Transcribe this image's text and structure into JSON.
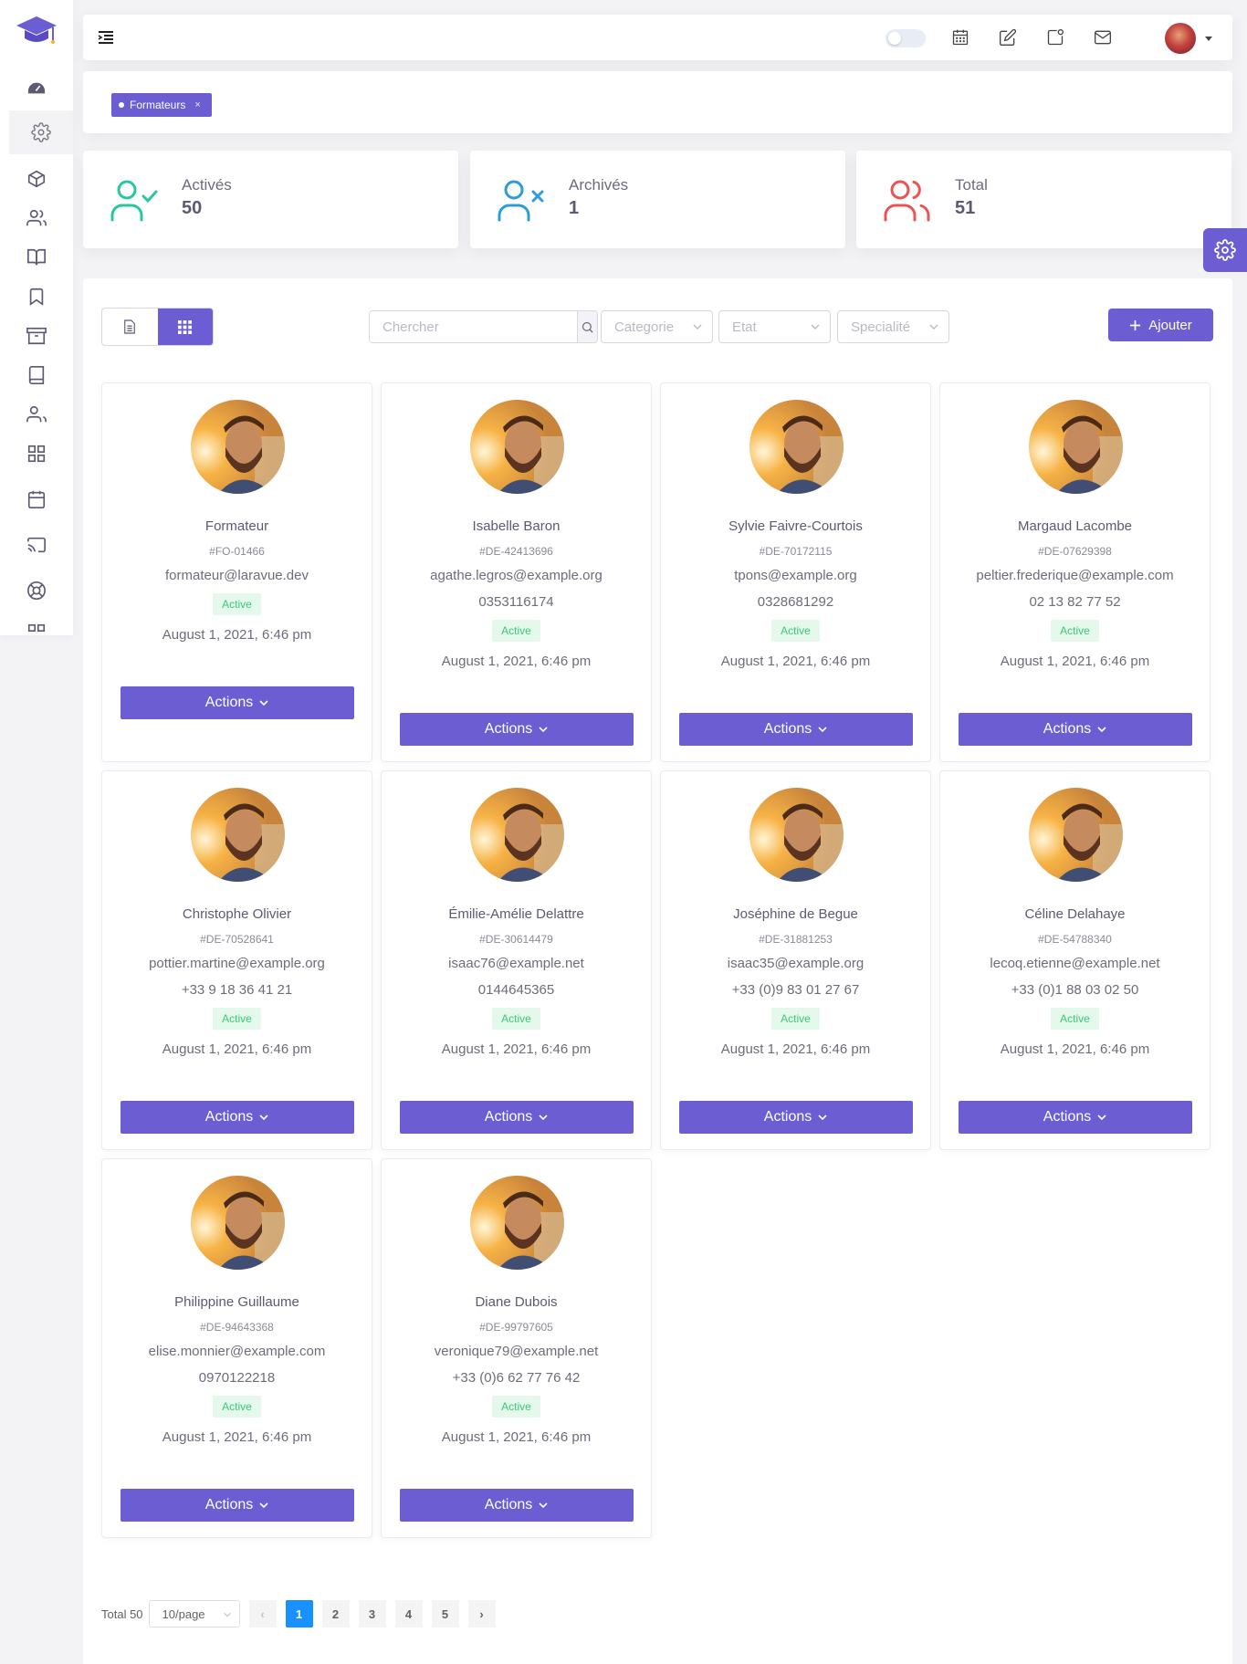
{
  "filter_tag": {
    "label": "Formateurs",
    "close": "×"
  },
  "stats": [
    {
      "label": "Activés",
      "value": "50",
      "color": "#28c7a0"
    },
    {
      "label": "Archivés",
      "value": "1",
      "color": "#2d9cdb"
    },
    {
      "label": "Total",
      "value": "51",
      "color": "#ea5455"
    }
  ],
  "toolbar": {
    "search_placeholder": "Chercher",
    "category_placeholder": "Categorie",
    "state_placeholder": "Etat",
    "specialty_placeholder": "Specialité",
    "add_label": "Ajouter"
  },
  "cards": [
    {
      "name": "Formateur",
      "code": "#FO-01466",
      "email": "formateur@laravue.dev",
      "phone": "",
      "status": "Active",
      "date": "August 1, 2021, 6:46 pm",
      "actions": "Actions"
    },
    {
      "name": "Isabelle Baron",
      "code": "#DE-42413696",
      "email": "agathe.legros@example.org",
      "phone": "0353116174",
      "status": "Active",
      "date": "August 1, 2021, 6:46 pm",
      "actions": "Actions"
    },
    {
      "name": "Sylvie Faivre-Courtois",
      "code": "#DE-70172115",
      "email": "tpons@example.org",
      "phone": "0328681292",
      "status": "Active",
      "date": "August 1, 2021, 6:46 pm",
      "actions": "Actions"
    },
    {
      "name": "Margaud Lacombe",
      "code": "#DE-07629398",
      "email": "peltier.frederique@example.com",
      "phone": "02 13 82 77 52",
      "status": "Active",
      "date": "August 1, 2021, 6:46 pm",
      "actions": "Actions"
    },
    {
      "name": "Christophe Olivier",
      "code": "#DE-70528641",
      "email": "pottier.martine@example.org",
      "phone": "+33 9 18 36 41 21",
      "status": "Active",
      "date": "August 1, 2021, 6:46 pm",
      "actions": "Actions"
    },
    {
      "name": "Émilie-Amélie Delattre",
      "code": "#DE-30614479",
      "email": "isaac76@example.net",
      "phone": "0144645365",
      "status": "Active",
      "date": "August 1, 2021, 6:46 pm",
      "actions": "Actions"
    },
    {
      "name": "Joséphine de Begue",
      "code": "#DE-31881253",
      "email": "isaac35@example.org",
      "phone": "+33 (0)9 83 01 27 67",
      "status": "Active",
      "date": "August 1, 2021, 6:46 pm",
      "actions": "Actions"
    },
    {
      "name": "Céline Delahaye",
      "code": "#DE-54788340",
      "email": "lecoq.etienne@example.net",
      "phone": "+33 (0)1 88 03 02 50",
      "status": "Active",
      "date": "August 1, 2021, 6:46 pm",
      "actions": "Actions"
    },
    {
      "name": "Philippine Guillaume",
      "code": "#DE-94643368",
      "email": "elise.monnier@example.com",
      "phone": "0970122218",
      "status": "Active",
      "date": "August 1, 2021, 6:46 pm",
      "actions": "Actions"
    },
    {
      "name": "Diane Dubois",
      "code": "#DE-99797605",
      "email": "veronique79@example.net",
      "phone": "+33 (0)6 62 77 76 42",
      "status": "Active",
      "date": "August 1, 2021, 6:46 pm",
      "actions": "Actions"
    }
  ],
  "pagination": {
    "total": "Total 50",
    "page_size": "10/page",
    "pages": [
      "1",
      "2",
      "3",
      "4",
      "5"
    ],
    "current": "1",
    "prev": "‹",
    "next": "›"
  },
  "colors": {
    "accent": "#6c5dd3",
    "active_badge": "#3cc878",
    "pager_active": "#1890ff"
  },
  "sidebar_icons": [
    "dashboard-icon",
    "settings-icon",
    "package-icon",
    "users-icon",
    "book-open-icon",
    "bookmark-icon",
    "archive-icon",
    "book-icon",
    "users-group-icon",
    "grid-icon",
    "calendar-icon",
    "cast-icon",
    "lifebuoy-icon",
    "apps-icon"
  ],
  "topbar_icons": [
    "menu-toggle-icon",
    "theme-toggle",
    "calendar-icon",
    "edit-icon",
    "notification-icon",
    "mail-icon",
    "user-avatar"
  ]
}
